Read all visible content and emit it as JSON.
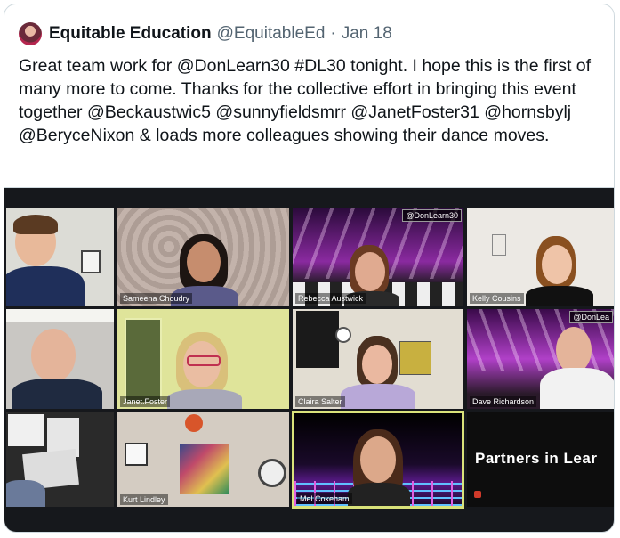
{
  "tweet": {
    "author_name": "Equitable Education",
    "author_handle": "@EquitableEd",
    "separator": "·",
    "date": "Jan 18",
    "text": "Great team work for @DonLearn30 #DL30 tonight.  I hope this is the first of many more to come.  Thanks for the collective effort in bringing this event together @Beckaustwic5 @sunnyfieldsmrr @JanetFoster31 @hornsbylj @BeryceNixon & loads more colleagues showing their dance moves."
  },
  "video_call": {
    "tiles": [
      {
        "label": ""
      },
      {
        "label": "Sameena Choudry"
      },
      {
        "label": "Rebecca Austwick",
        "tag": "@DonLearn30"
      },
      {
        "label": "Kelly Cousins"
      },
      {
        "label": ""
      },
      {
        "label": "Janet.Foster"
      },
      {
        "label": "Claira Salter"
      },
      {
        "label": "Dave Richardson",
        "tag": "@DonLea"
      },
      {
        "label": ""
      },
      {
        "label": "Kurt Lindley"
      },
      {
        "label": "Mel Cokeham"
      },
      {
        "label": ""
      }
    ],
    "banner_text": "Partners in Lear"
  },
  "colors": {
    "active_speaker_border": "#d9e27a",
    "disco_pink": "#c040d0"
  }
}
